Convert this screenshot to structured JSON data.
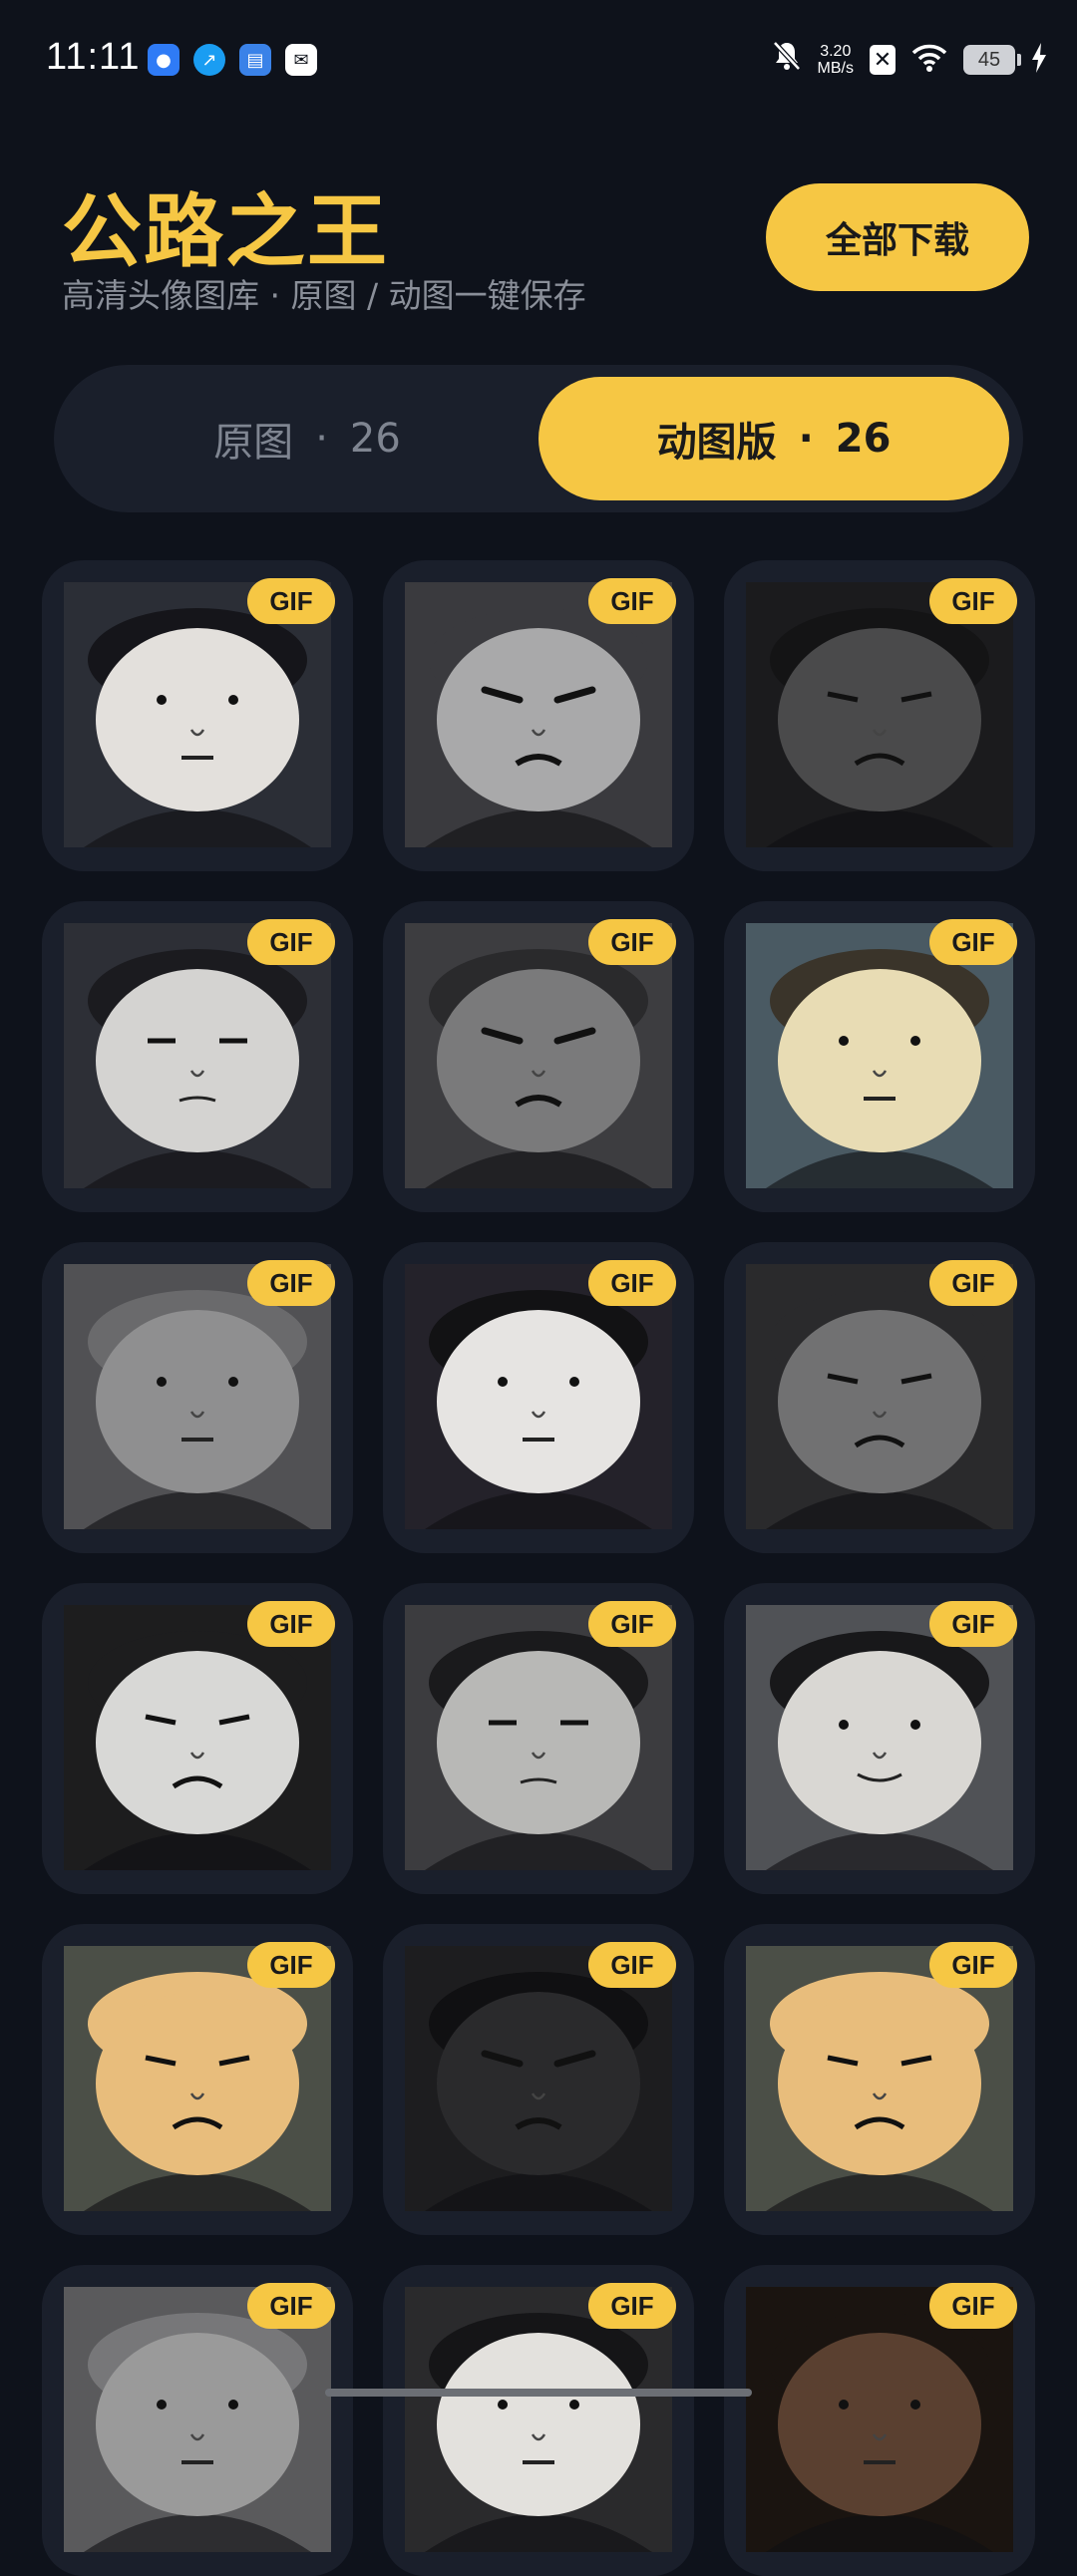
{
  "status_bar": {
    "time": "11:11",
    "net_speed_value": "3.20",
    "net_speed_unit": "MB/s",
    "battery": "45",
    "icons": [
      "mute-bell-icon",
      "close-box-icon",
      "wifi-icon",
      "battery-icon",
      "charging-icon"
    ],
    "apps": [
      {
        "name": "app-baidu-icon",
        "color": "#2f7bf6"
      },
      {
        "name": "app-alipay-icon",
        "color": "#1a9df2"
      },
      {
        "name": "app-ticket-icon",
        "color": "#3a82e8"
      },
      {
        "name": "app-mail-icon",
        "color": "#ffffff"
      }
    ]
  },
  "header": {
    "title": "公路之王",
    "subtitle": "高清头像图库 · 原图 / 动图一键保存",
    "download_all_label": "全部下载"
  },
  "tabs": [
    {
      "label": "原图",
      "count": "26",
      "active": false
    },
    {
      "label": "动图版",
      "count": "26",
      "active": true
    }
  ],
  "badge_label": "GIF",
  "grid": {
    "items": [
      {
        "bg": "#2b2e36",
        "face": "#e3e0dc",
        "hair": "#15151a",
        "expression": "neutral"
      },
      {
        "bg": "#3a3a3e",
        "face": "#a9a9aa",
        "hair": "#3a3a3e",
        "expression": "angry"
      },
      {
        "bg": "#1b1b1d",
        "face": "#4a4a4b",
        "hair": "#141415",
        "expression": "frown"
      },
      {
        "bg": "#2d2f36",
        "face": "#d4d3d1",
        "hair": "#1b1b1f",
        "expression": "tired"
      },
      {
        "bg": "#3d3d40",
        "face": "#7a7a7b",
        "hair": "#2a2a2c",
        "expression": "angry"
      },
      {
        "bg": "#4a5a63",
        "face": "#e8dcb4",
        "hair": "#3a342a",
        "expression": "neutral"
      },
      {
        "bg": "#515154",
        "face": "#8f8f90",
        "hair": "#6a6a6c",
        "expression": "neutral"
      },
      {
        "bg": "#24222a",
        "face": "#e6e4e2",
        "hair": "#121214",
        "expression": "neutral"
      },
      {
        "bg": "#2a2a2c",
        "face": "#717172",
        "hair": "#2a2a2c",
        "expression": "frown"
      },
      {
        "bg": "#1d1d1e",
        "face": "#d8d8d6",
        "hair": "#1d1d1e",
        "expression": "frown"
      },
      {
        "bg": "#3c3c3f",
        "face": "#b8b8b6",
        "hair": "#1a1a1c",
        "expression": "tired"
      },
      {
        "bg": "#505256",
        "face": "#d9d7d3",
        "hair": "#18181a",
        "expression": "smile"
      },
      {
        "bg": "#4b4f47",
        "face": "#e8bd7c",
        "hair": "#e8bd7c",
        "expression": "frown"
      },
      {
        "bg": "#1d1d1f",
        "face": "#2a2a2c",
        "hair": "#101012",
        "expression": "angry"
      },
      {
        "bg": "#4b4f47",
        "face": "#e8bd7c",
        "hair": "#e8bd7c",
        "expression": "frown"
      },
      {
        "bg": "#5a5a5c",
        "face": "#9a9a9a",
        "hair": "#777779",
        "expression": "neutral"
      },
      {
        "bg": "#2a2a2c",
        "face": "#e3e1dd",
        "hair": "#151517",
        "expression": "neutral"
      },
      {
        "bg": "#1a1410",
        "face": "#5a4030",
        "hair": "#1a1410",
        "expression": "neutral"
      }
    ]
  },
  "colors": {
    "accent": "#f6c744",
    "background": "#0e121b",
    "card": "#1a1f2b",
    "muted_text": "#8a8f99"
  }
}
